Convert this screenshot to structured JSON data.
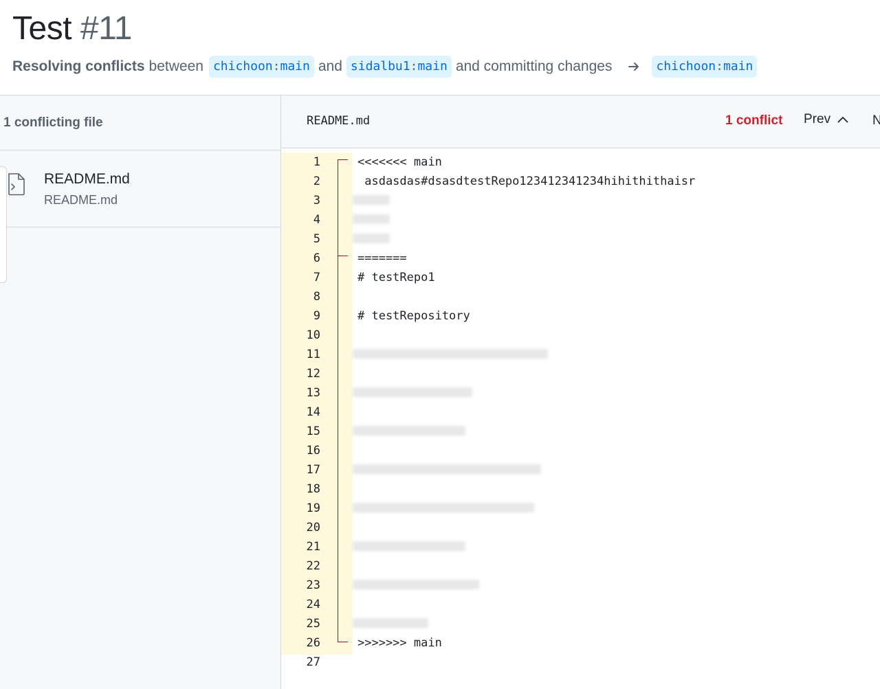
{
  "header": {
    "title": "Test",
    "number": "#11",
    "subtitle_strong": "Resolving conflicts",
    "subtitle_between": "between",
    "subtitle_and": "and",
    "subtitle_tail": "and committing changes",
    "head_branch": {
      "owner": "chichoon",
      "sep": ":",
      "name": "main"
    },
    "base_branch": {
      "owner": "sidalbu1",
      "sep": ":",
      "name": "main"
    },
    "target_branch": {
      "owner": "chichoon",
      "sep": ":",
      "name": "main"
    },
    "arrow_icon": "arrow-right-icon"
  },
  "sidebar": {
    "heading": "1 conflicting file",
    "files": [
      {
        "name": "README.md",
        "path": "README.md",
        "icon": "file-diff-icon"
      }
    ]
  },
  "editor": {
    "filename": "README.md",
    "conflict_count": "1 conflict",
    "prev_label": "Prev",
    "next_label": "N",
    "lines": [
      {
        "n": "1",
        "text": "<<<<<<< main"
      },
      {
        "n": "2",
        "text": " asdasdas#dsasdtestRepo123412341234hihithithaisr"
      },
      {
        "n": "3",
        "text": ""
      },
      {
        "n": "4",
        "text": ""
      },
      {
        "n": "5",
        "text": ""
      },
      {
        "n": "6",
        "text": "======="
      },
      {
        "n": "7",
        "text": "# testRepo1"
      },
      {
        "n": "8",
        "text": ""
      },
      {
        "n": "9",
        "text": "# testRepository"
      },
      {
        "n": "10",
        "text": ""
      },
      {
        "n": "11",
        "text": ""
      },
      {
        "n": "12",
        "text": ""
      },
      {
        "n": "13",
        "text": ""
      },
      {
        "n": "14",
        "text": ""
      },
      {
        "n": "15",
        "text": ""
      },
      {
        "n": "16",
        "text": ""
      },
      {
        "n": "17",
        "text": ""
      },
      {
        "n": "18",
        "text": ""
      },
      {
        "n": "19",
        "text": ""
      },
      {
        "n": "20",
        "text": ""
      },
      {
        "n": "21",
        "text": ""
      },
      {
        "n": "22",
        "text": ""
      },
      {
        "n": "23",
        "text": ""
      },
      {
        "n": "24",
        "text": ""
      },
      {
        "n": "25",
        "text": ""
      },
      {
        "n": "26",
        "text": ">>>>>>> main"
      },
      {
        "n": "27",
        "text": ""
      }
    ]
  },
  "colors": {
    "conflict_red": "#cf222e",
    "branch_bg": "#ddf4ff",
    "branch_fg": "#0969da",
    "gutter_bg": "#fff8dc",
    "marker": "#a40e26"
  }
}
